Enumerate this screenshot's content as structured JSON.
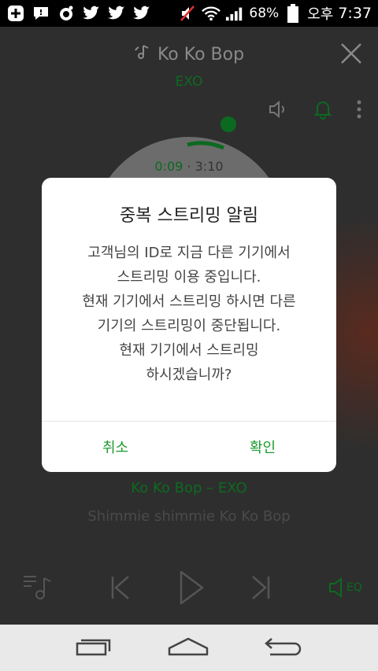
{
  "status_bar": {
    "battery": "68%",
    "ampm": "오후",
    "time": "7:37"
  },
  "player": {
    "song_title": "Ko Ko Bop",
    "artist": "EXO",
    "time_current": "0:09",
    "time_total": "3:10",
    "lyric_title": "Ko Ko Bop – EXO",
    "lyric_line": "Shimmie shimmie Ko Ko Bop",
    "eq_label": "EQ"
  },
  "dialog": {
    "title": "중복 스트리밍 알림",
    "body_lines": [
      "고객님의 ID로 지금 다른 기기에서",
      "스트리밍 이용 중입니다.",
      "현재 기기에서 스트리밍 하시면 다른",
      "기기의 스트리밍이 중단됩니다.",
      "현재 기기에서 스트리밍",
      "하시겠습니까?"
    ],
    "cancel_label": "취소",
    "ok_label": "확인"
  },
  "colors": {
    "accent": "#1a9a2c",
    "dim_accent": "#0c6a20"
  },
  "icons": [
    "add-icon",
    "message-icon",
    "record-icon",
    "twitter-icon",
    "mute-icon",
    "wifi-icon",
    "signal-icon",
    "battery-icon",
    "music-note-icon",
    "close-icon",
    "volume-icon",
    "bell-icon",
    "more-icon",
    "playlist-icon",
    "previous-icon",
    "play-icon",
    "next-icon",
    "eq-icon",
    "recent-apps-icon",
    "home-icon",
    "back-icon"
  ]
}
